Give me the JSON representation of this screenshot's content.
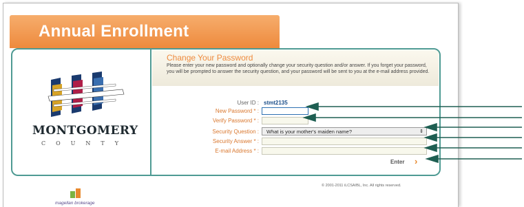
{
  "header": {
    "title": "Annual Enrollment"
  },
  "logo": {
    "name": "MONTGOMERY",
    "subtitle": "COUNTY"
  },
  "form": {
    "title": "Change Your Password",
    "description": "Please enter your new password and optionally change your security question and/or answer. If you forget your password, you will be prompted to answer the security question, and your password will be sent to you at the e-mail address provided.",
    "user_id_label": "User ID :",
    "user_id_value": "stmt2135",
    "new_password_label": "New Password * :",
    "verify_password_label": "Verify Password * :",
    "security_question_label": "Security Question :",
    "security_question_value": "What is your mother's maiden name?",
    "security_answer_label": "Security Answer * :",
    "email_label": "E-mail Address * :",
    "enter_label": "Enter"
  },
  "footer": {
    "copyright": "© 2001-2011 iLCSA/BL, Inc. All rights reserved.",
    "brand": "magellan brokerage"
  },
  "colors": {
    "accent": "#ee8a3d",
    "border": "#4e9a93",
    "arrow": "#1e5f52"
  }
}
